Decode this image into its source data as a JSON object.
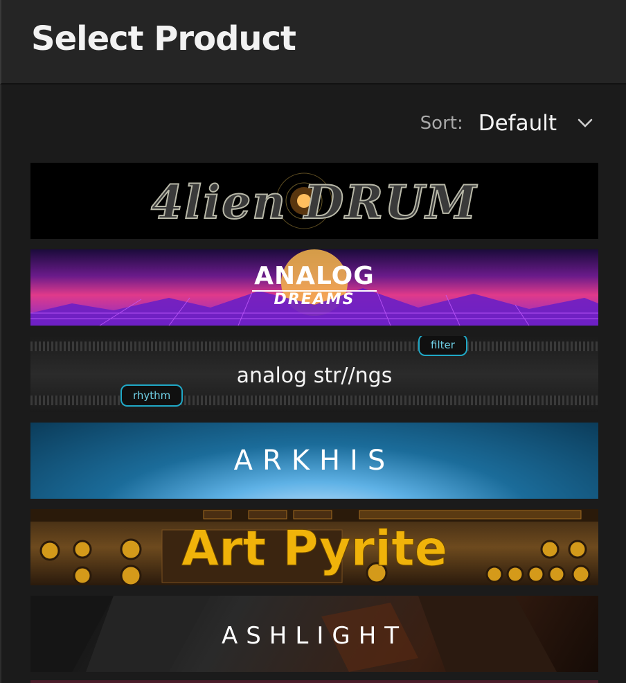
{
  "header": {
    "title": "Select Product"
  },
  "sort": {
    "label": "Sort:",
    "value": "Default"
  },
  "products": [
    {
      "name": "Alien Drum",
      "banner_text": "4lien DRUM"
    },
    {
      "name": "Analog Dreams",
      "banner_text": "ANALOG",
      "banner_subtext": "DREAMS"
    },
    {
      "name": "Analog Strings",
      "banner_text": "analog str//ngs",
      "tags": [
        "filter",
        "rhythm"
      ]
    },
    {
      "name": "Arkhis",
      "banner_text": "ARKHIS"
    },
    {
      "name": "Art Pyrite",
      "banner_text": "Art Pyrite"
    },
    {
      "name": "Ashlight",
      "banner_text": "ASHLIGHT"
    }
  ],
  "colors": {
    "accent_cyan": "#20a9c7",
    "pyrite_gold": "#f0b30a",
    "background": "#1b1b1b"
  }
}
